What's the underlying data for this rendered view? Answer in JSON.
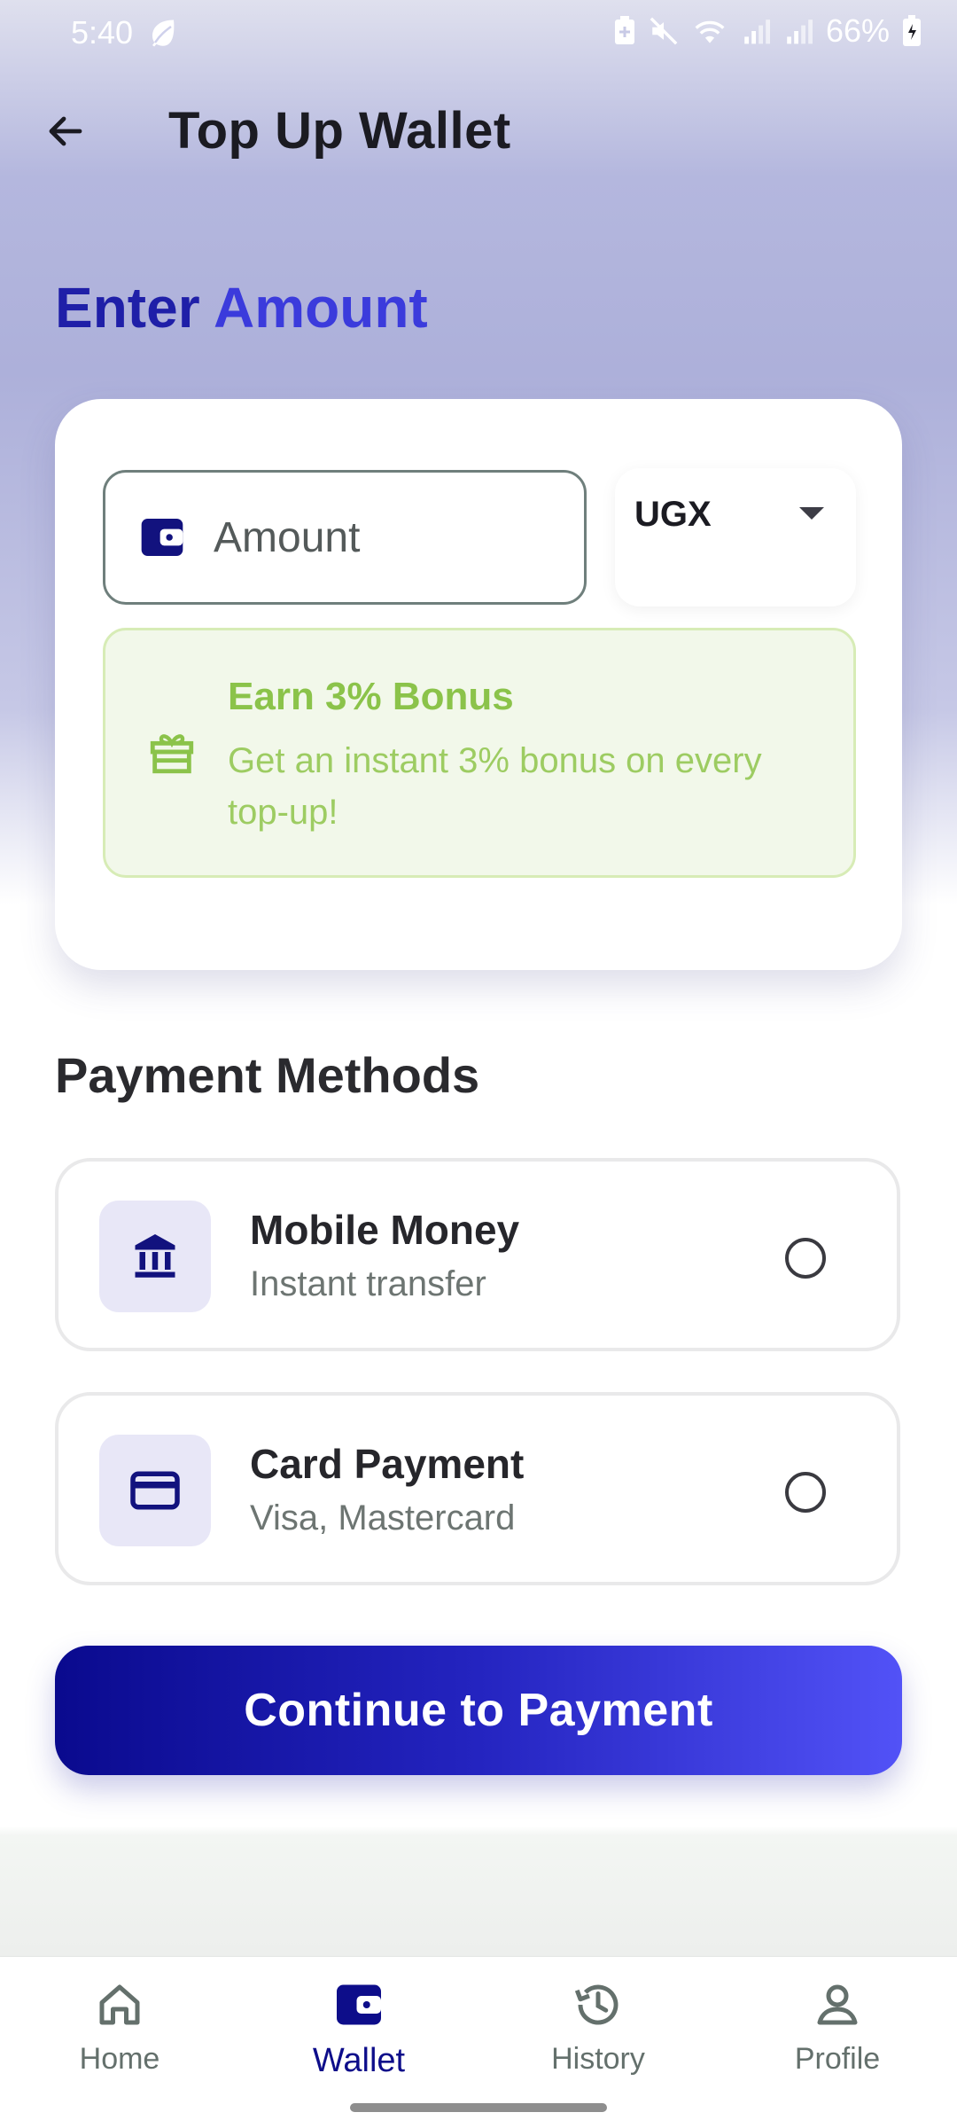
{
  "status_bar": {
    "time": "5:40",
    "battery": "66%",
    "icons": [
      "leaf-icon",
      "battery-saver-icon",
      "mute-icon",
      "wifi-icon",
      "signal-icon",
      "signal-icon-2",
      "battery-charging-icon"
    ]
  },
  "header": {
    "back_icon": "arrow-left-icon",
    "title": "Top Up Wallet"
  },
  "amount_section": {
    "heading_word1": "Enter",
    "heading_word2": "Amount",
    "amount_placeholder": "Amount",
    "amount_value": "",
    "currency": "UGX",
    "bonus_title": "Earn 3% Bonus",
    "bonus_description": "Get an instant 3% bonus on every top-up!"
  },
  "payment_methods": {
    "heading": "Payment Methods",
    "items": [
      {
        "title": "Mobile Money",
        "subtitle": "Instant transfer",
        "icon": "bank-icon",
        "selected": false
      },
      {
        "title": "Card Payment",
        "subtitle": "Visa, Mastercard",
        "icon": "credit-card-icon",
        "selected": false
      }
    ]
  },
  "continue_label": "Continue to Payment",
  "bottom_nav": {
    "items": [
      {
        "label": "Home",
        "icon": "home-icon",
        "active": false
      },
      {
        "label": "Wallet",
        "icon": "wallet-icon",
        "active": true
      },
      {
        "label": "History",
        "icon": "history-icon",
        "active": false
      },
      {
        "label": "Profile",
        "icon": "profile-icon",
        "active": false
      }
    ]
  },
  "colors": {
    "primary": "#0d0d8a",
    "accent": "#3b3bdc",
    "bonus_green": "#8bc34a",
    "bonus_bg": "#f2f8ea"
  }
}
